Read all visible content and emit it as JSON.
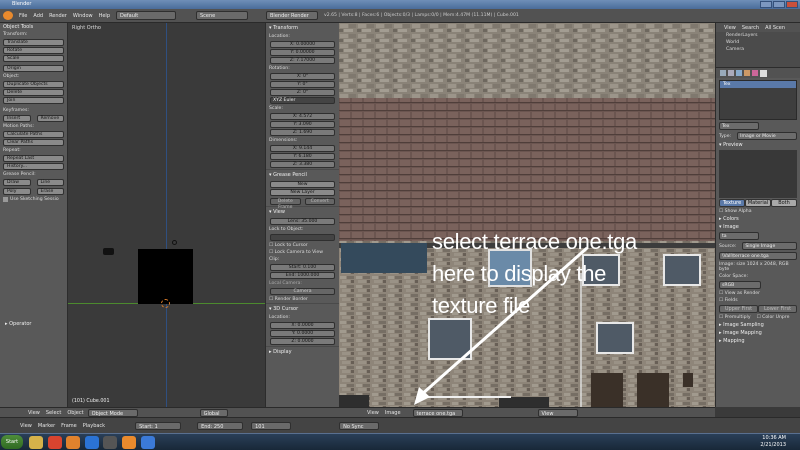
{
  "title_bar": {
    "title": "Blender"
  },
  "top_header": {
    "menus": [
      "File",
      "Add",
      "Render",
      "Window",
      "Help"
    ],
    "screen_layout": "Default",
    "scene": "Scene",
    "render_engine": "Blender Render",
    "stats": "v2.65 | Verts:8 | Faces:6 | Objects:0/3 | Lamps:0/0 | Mem:4.47M (11.11M) | Cube.001"
  },
  "tool_shelf": {
    "header": "Object Tools",
    "transform_label": "Transform:",
    "transform_buttons": [
      "Translate",
      "Rotate",
      "Scale"
    ],
    "origin_button": "Origin",
    "object_label": "Object:",
    "object_buttons": [
      "Duplicate Objects",
      "Delete",
      "Join"
    ],
    "keyframes_label": "Keyframes:",
    "keyframe_insert": "Insert",
    "keyframe_remove": "Remove",
    "motion_paths_label": "Motion Paths:",
    "motion_path_buttons": [
      "Calculate Paths",
      "Clear Paths"
    ],
    "repeat_label": "Repeat:",
    "repeat_buttons": [
      "Repeat Last",
      "History..."
    ],
    "grease_label": "Grease Pencil:",
    "grease_draw": "Draw",
    "grease_line": "Line",
    "grease_poly": "Poly",
    "grease_erase": "Erase",
    "sketching": "Use Sketching Sessio",
    "operator": "Operator"
  },
  "viewport": {
    "view_label": "Right Ortho",
    "object_label": "(101) Cube.001",
    "header_menus": [
      "View",
      "Select",
      "Object"
    ],
    "mode": "Object Mode",
    "pivot": "Global"
  },
  "n_panel": {
    "transform_header": "Transform",
    "location_label": "Location:",
    "location": [
      "X: 0.00000",
      "Y: 0.00000",
      "Z: 7.17000"
    ],
    "rotation_label": "Rotation:",
    "rotation": [
      "X: 0°",
      "Y: 0°",
      "Z: 0°"
    ],
    "rotation_mode": "XYZ Euler",
    "scale_label": "Scale:",
    "scale": [
      "X: 4.572",
      "Y: 3.090",
      "Z: 1.690"
    ],
    "dimensions_label": "Dimensions:",
    "dimensions": [
      "X: 9.144",
      "Y: 6.180",
      "Z: 3.380"
    ],
    "grease_header": "Grease Pencil",
    "grease_new": "New",
    "grease_new_layer": "New Layer",
    "grease_delete_frame": "Delete Frame",
    "grease_convert": "Convert",
    "view_header": "View",
    "lens": "Lens: 35.000",
    "lock_to_object": "Lock to Object:",
    "lock_to_cursor": "Lock to Cursor",
    "lock_camera": "Lock Camera to View",
    "clip_label": "Clip:",
    "clip_start": "Start: 0.100",
    "clip_end": "End: 1000.000",
    "local_camera": "Local Camera:",
    "camera": "Camera",
    "render_border": "Render Border",
    "cursor_header": "3D Cursor",
    "cursor_location": "Location:",
    "cursor": [
      "X: 0.0000",
      "Y: 0.0000",
      "Z: 0.0000"
    ],
    "display_header": "Display"
  },
  "image_editor": {
    "header_menus": [
      "View",
      "Image"
    ],
    "image_name": "terrace one.tga",
    "view_dropdown": "View"
  },
  "annotation": {
    "line1": "select terrace one.tga",
    "line2": "here to display the",
    "line3": "texture file"
  },
  "outliner": {
    "items": [
      "View",
      "Search",
      "All Scen",
      "RenderLayers",
      "World",
      "Camera"
    ]
  },
  "properties": {
    "texture_slot": "Tex",
    "texture_name": "Tex",
    "type_label": "Type:",
    "type_value": "Image or Movie",
    "preview": "Preview",
    "tabs": [
      "Texture",
      "Material",
      "Both"
    ],
    "show_alpha": "Show Alpha",
    "colors": "Colors",
    "image": "Image",
    "image_name": "ta",
    "source_label": "Source:",
    "source_value": "Single Image",
    "filepath": "\\Vall\\terrace one.tga",
    "image_info": "Image: size 1024 x 2048, RGB byte",
    "color_space_label": "Color Space:",
    "color_space": "sRGB",
    "view_as_render": "View as Render",
    "fields": "Fields",
    "upper_first": "Upper First",
    "lower_first": "Lower First",
    "premultiply": "Premultiply",
    "color_unpremultiply": "Color Unpre",
    "image_sampling": "Image Sampling",
    "image_mapping": "Image Mapping",
    "mapping": "Mapping"
  },
  "timeline": {
    "menus": [
      "View",
      "Marker",
      "Frame",
      "Playback"
    ],
    "start": "Start: 1",
    "end": "End: 250",
    "current": "101",
    "sync": "No Sync"
  },
  "taskbar": {
    "start": "Start",
    "time": "10:36 AM",
    "date": "2/21/2013"
  }
}
